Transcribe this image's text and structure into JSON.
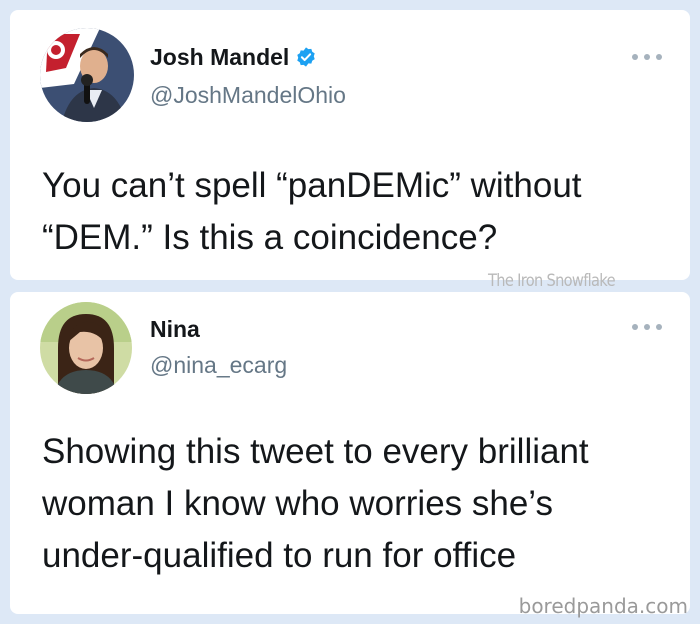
{
  "tweets": [
    {
      "name": "Josh Mandel",
      "handle": "@JoshMandelOhio",
      "verified": true,
      "text_lines": [
        "You can’t spell “panDEMic” without",
        "“DEM.” Is this a coincidence?"
      ]
    },
    {
      "name": "Nina",
      "handle": "@nina_ecarg",
      "verified": false,
      "text_lines": [
        "Showing this tweet to every brilliant",
        "woman I know who worries she’s",
        "under-qualified to run for office"
      ]
    }
  ],
  "watermark": "The Iron Snowflake",
  "credit": "boredpanda.com",
  "colors": {
    "page_background": "#dde8f6",
    "verified_badge": "#1da1f2",
    "handle_text": "#657786"
  },
  "icons": {
    "verified": "verified-badge-icon",
    "more": "more-options-icon"
  }
}
